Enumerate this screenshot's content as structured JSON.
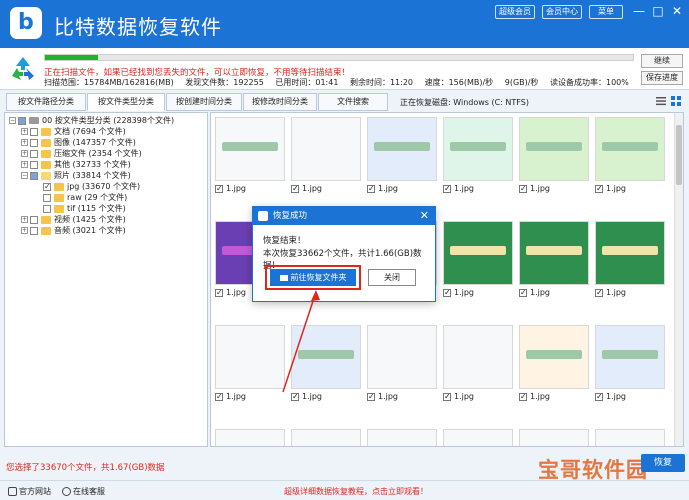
{
  "app": {
    "title": "比特数据恢复软件",
    "top_buttons": [
      "超级会员",
      "会员中心",
      "菜单"
    ],
    "window_controls": [
      "—",
      "□",
      "✕"
    ]
  },
  "scan": {
    "progress": 0.09,
    "message": "正在扫描文件，如果已经找到您丢失的文件，可以立即恢复，不用等待扫描结束！",
    "stats": {
      "range": "扫描范围：15784MB/162816(MB)",
      "found": "发现文件数：192255",
      "elapsed": "已用时间：01:41",
      "remaining": "剩余时间：11:20",
      "speed": "速度：156(MB)/秒",
      "percent": "9(GB)/秒",
      "success": "读设备成功率：100%"
    },
    "buttons": {
      "continue": "继续",
      "save_progress": "保存进度"
    }
  },
  "tabs": [
    "按文件路径分类",
    "按文件类型分类",
    "按创建时间分类",
    "按修改时间分类",
    "文件搜索"
  ],
  "active_tab": 1,
  "disk_label": "正在恢复磁盘: Windows (C: NTFS)",
  "tree": [
    {
      "label": "00 按文件类型分类",
      "count": "(228398个文件)",
      "indent": 0
    },
    {
      "label": "文档",
      "count": "(7694 个文件)",
      "indent": 1
    },
    {
      "label": "图像",
      "count": "(147357 个文件)",
      "indent": 1
    },
    {
      "label": "压缩文件",
      "count": "(2354 个文件)",
      "indent": 1
    },
    {
      "label": "其他",
      "count": "(32733 个文件)",
      "indent": 1
    },
    {
      "label": "照片",
      "count": "(33814 个文件)",
      "indent": 1
    },
    {
      "label": "jpg",
      "count": "(33670 个文件)",
      "indent": 2
    },
    {
      "label": "raw",
      "count": "(29 个文件)",
      "indent": 2
    },
    {
      "label": "tif",
      "count": "(115 个文件)",
      "indent": 2
    },
    {
      "label": "视频",
      "count": "(1425 个文件)",
      "indent": 1
    },
    {
      "label": "音频",
      "count": "(3021 个文件)",
      "indent": 1
    }
  ],
  "grid": {
    "file_label": "1.jpg"
  },
  "dialog": {
    "title": "恢复成功",
    "line1": "恢复结束！",
    "line2": "本次恢复33662个文件，共计1.66(GB)数据！",
    "open_folder": "前往恢复文件夹",
    "close": "关闭"
  },
  "status_text": "您选择了33670个文件，共1.67(GB)数据",
  "footer": {
    "official_site": "官方网站",
    "online_service": "在线客服",
    "tutorial_link": "超级详细数据恢复教程，点击立即观看！"
  },
  "recover_button": "恢复",
  "watermark": "宝哥软件园",
  "colors": {
    "brand": "#1c73d6",
    "alert": "#e0261c",
    "progress": "#19b52a"
  }
}
